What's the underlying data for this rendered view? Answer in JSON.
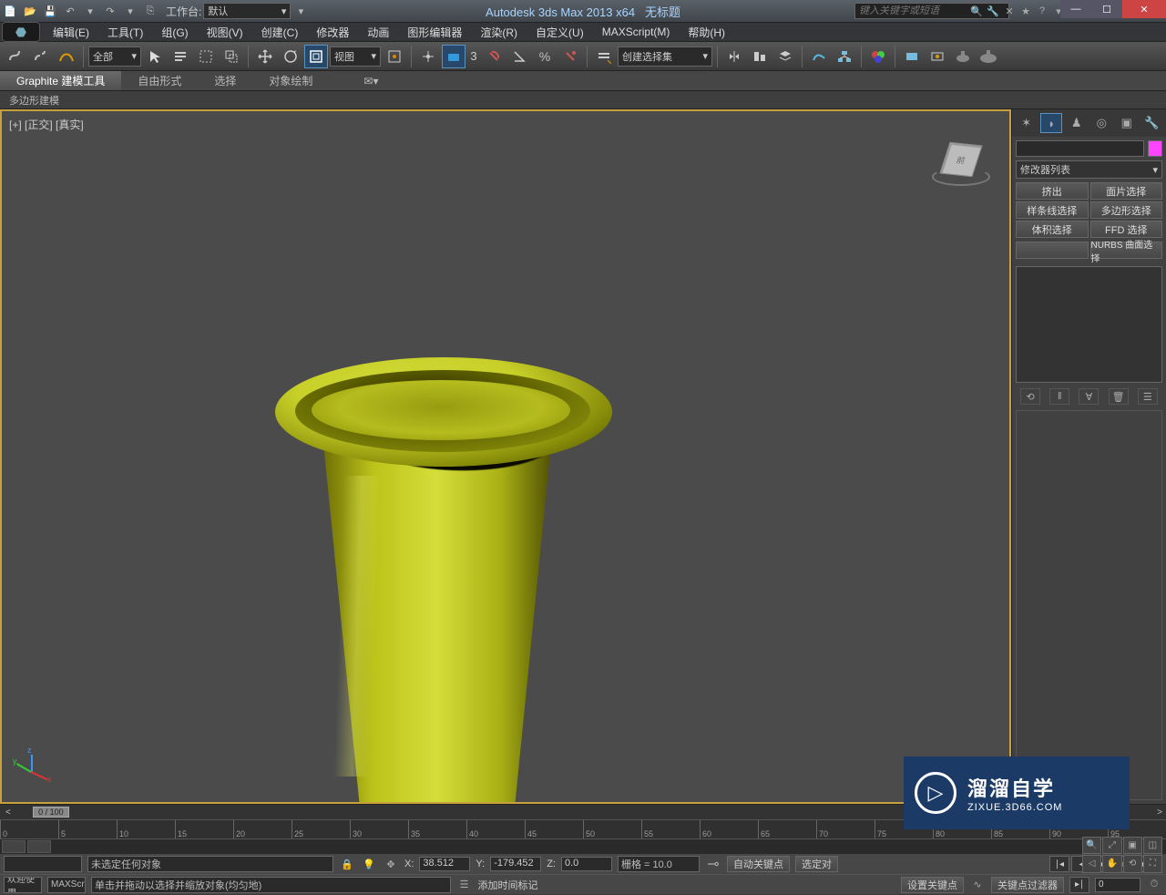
{
  "title_bar": {
    "app_title": "Autodesk 3ds Max  2013 x64",
    "doc_title": "无标题",
    "workspace_label": "工作台:",
    "workspace_value": "默认",
    "search_placeholder": "键入关键字或短语"
  },
  "menu": {
    "edit": "编辑(E)",
    "tools": "工具(T)",
    "group": "组(G)",
    "views": "视图(V)",
    "create": "创建(C)",
    "modifiers": "修改器",
    "animation": "动画",
    "graph": "图形编辑器",
    "rendering": "渲染(R)",
    "customize": "自定义(U)",
    "maxscript": "MAXScript(M)",
    "help": "帮助(H)"
  },
  "toolbar": {
    "filter_all": "全部",
    "view_dd": "视图",
    "snap_num": "3",
    "selset_dd": "创建选择集"
  },
  "ribbon": {
    "t1": "Graphite 建模工具",
    "t2": "自由形式",
    "t3": "选择",
    "t4": "对象绘制",
    "sub": "多边形建模"
  },
  "viewport": {
    "label": "[+] [正交] [真实]",
    "cube_face": "前"
  },
  "cmd": {
    "mod_list": "修改器列表",
    "b1": "挤出",
    "b2": "面片选择",
    "b3": "样条线选择",
    "b4": "多边形选择",
    "b5": "体积选择",
    "b6": "FFD 选择",
    "b7": "NURBS 曲面选择"
  },
  "timeline": {
    "pos": "0 / 100",
    "ticks": [
      "0",
      "5",
      "10",
      "15",
      "20",
      "25",
      "30",
      "35",
      "40",
      "45",
      "50",
      "55",
      "60",
      "65",
      "70",
      "75",
      "80",
      "85",
      "90",
      "95"
    ]
  },
  "status": {
    "welcome": "欢迎使用",
    "maxscr": "MAXScr",
    "sel_none": "未选定任何对象",
    "hint": "单击并拖动以选择并缩放对象(均匀地)",
    "x_label": "X:",
    "x": "38.512",
    "y_label": "Y:",
    "y": "-179.452",
    "z_label": "Z:",
    "z": "0.0",
    "grid": "栅格 = 10.0",
    "auto_key": "自动关键点",
    "set_key": "设置关键点",
    "sel_lock": "选定对",
    "key_filter": "关键点过滤器",
    "add_time_tag": "添加时间标记",
    "frame": "0"
  },
  "watermark": {
    "t1": "溜溜自学",
    "t2": "ZIXUE.3D66.COM"
  }
}
